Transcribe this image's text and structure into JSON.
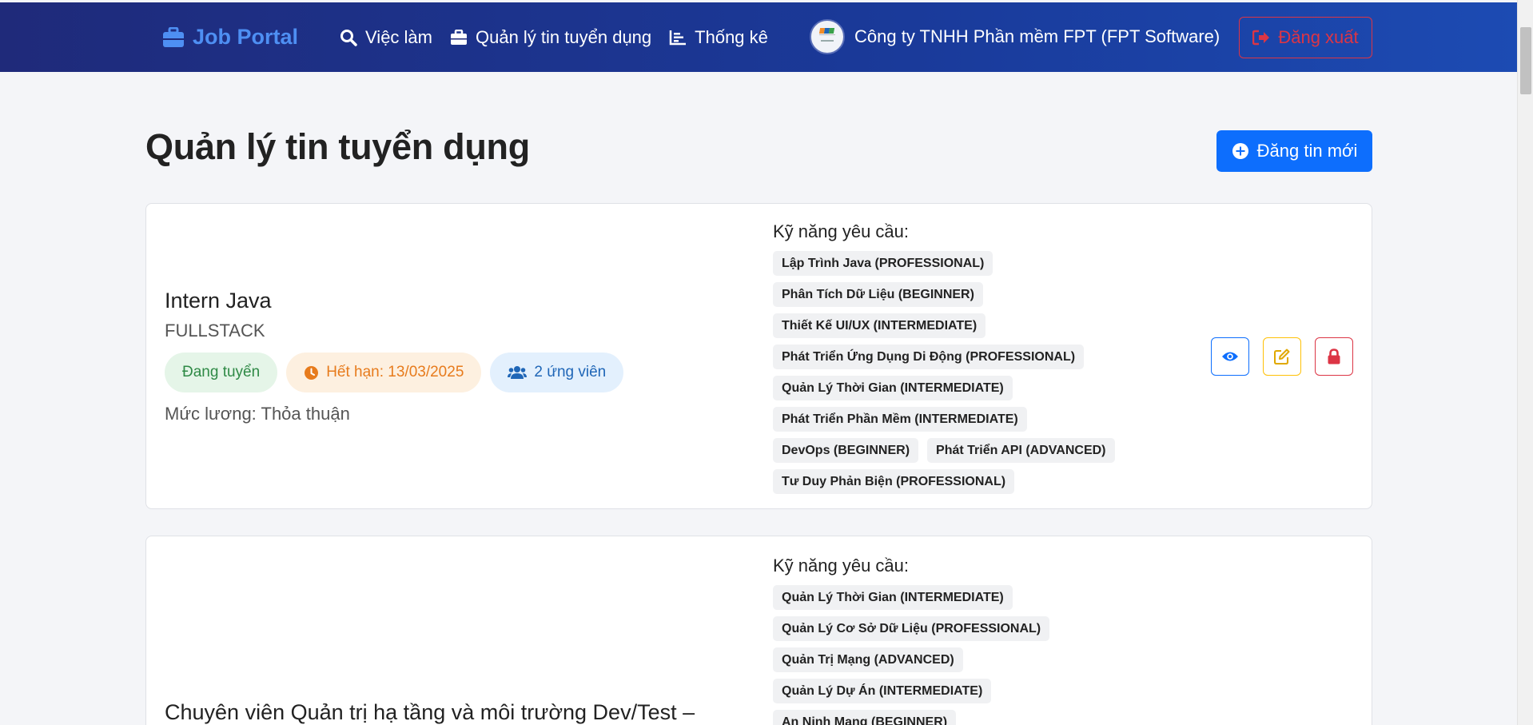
{
  "nav": {
    "brand": "Job Portal",
    "links": [
      "Việc làm",
      "Quản lý tin tuyển dụng",
      "Thống kê"
    ],
    "company": "Công ty TNHH Phần mềm FPT (FPT Software)",
    "logout": "Đăng xuất"
  },
  "page": {
    "title": "Quản lý tin tuyển dụng",
    "new_button": "Đăng tin mới"
  },
  "jobs": [
    {
      "title": "Intern Java",
      "type": "FULLSTACK",
      "status": "Đang tuyển",
      "deadline": "Hết hạn: 13/03/2025",
      "applicants": "2 ứng viên",
      "salary": "Mức lương: Thỏa thuận",
      "skills_title": "Kỹ năng yêu cầu:",
      "skills": [
        "Lập Trình Java (PROFESSIONAL)",
        "Phân Tích Dữ Liệu (BEGINNER)",
        "Thiết Kế UI/UX (INTERMEDIATE)",
        "Phát Triển Ứng Dụng Di Động (PROFESSIONAL)",
        "Quản Lý Thời Gian (INTERMEDIATE)",
        "Phát Triển Phần Mềm (INTERMEDIATE)",
        "DevOps (BEGINNER)",
        "Phát Triển API (ADVANCED)",
        "Tư Duy Phản Biện (PROFESSIONAL)"
      ]
    },
    {
      "title": "Chuyên viên Quản trị hạ tầng và môi trường Dev/Test –",
      "skills_title": "Kỹ năng yêu cầu:",
      "skills": [
        "Quản Lý Thời Gian (INTERMEDIATE)",
        "Quản Lý Cơ Sở Dữ Liệu (PROFESSIONAL)",
        "Quản Trị Mạng (ADVANCED)",
        "Quản Lý Dự Án (INTERMEDIATE)",
        "An Ninh Mạng (BEGINNER)"
      ]
    }
  ],
  "colors": {
    "primary": "#0d6efd",
    "danger": "#dc3545",
    "warning": "#ffc107",
    "nav_start": "#1f2a7a",
    "nav_end": "#1c4bb3"
  }
}
